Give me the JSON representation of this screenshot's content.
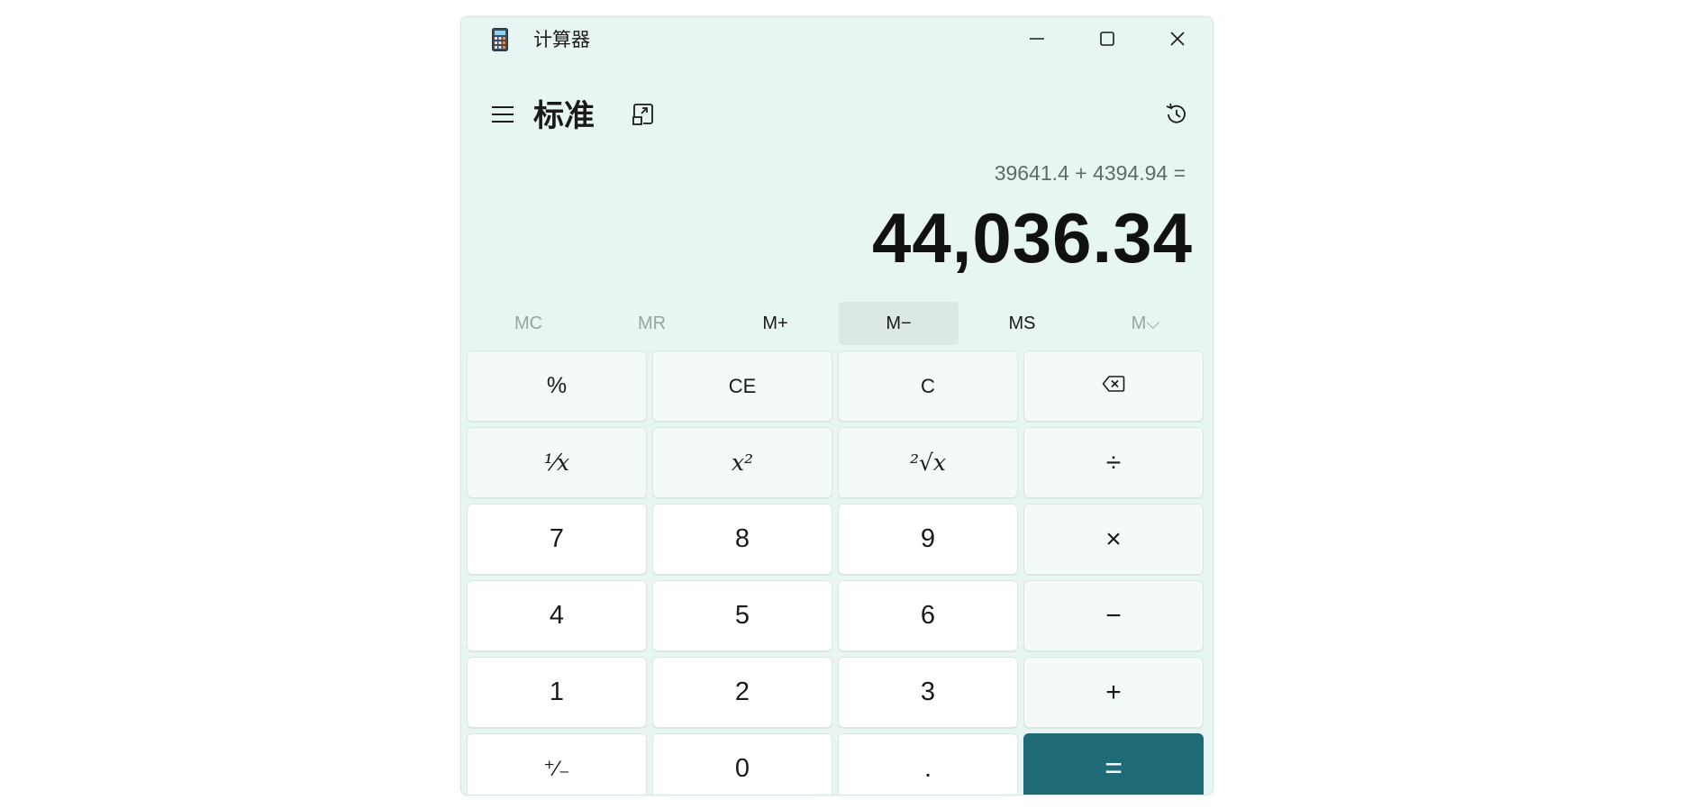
{
  "window": {
    "app_title": "计算器",
    "icons": {
      "app": "calculator-icon",
      "minimize": "minimize-icon",
      "maximize": "maximize-icon",
      "close": "close-icon"
    }
  },
  "header": {
    "mode_title": "标准",
    "icons": {
      "menu": "hamburger-menu-icon",
      "keep_on_top": "keep-on-top-icon",
      "history": "history-icon"
    }
  },
  "display": {
    "expression": "39641.4 + 4394.94 =",
    "result": "44,036.34"
  },
  "memory": [
    {
      "label": "MC",
      "enabled": false
    },
    {
      "label": "MR",
      "enabled": false
    },
    {
      "label": "M+",
      "enabled": true
    },
    {
      "label": "M−",
      "enabled": true,
      "hovered": true
    },
    {
      "label": "MS",
      "enabled": true
    },
    {
      "label": "M⌵",
      "enabled": false
    }
  ],
  "keys": {
    "percent": "%",
    "clear_entry": "CE",
    "clear": "C",
    "backspace": "backspace-icon",
    "reciprocal": "⅟x",
    "square": "x²",
    "sqrt": "²√x",
    "divide": "÷",
    "seven": "7",
    "eight": "8",
    "nine": "9",
    "multiply": "×",
    "four": "4",
    "five": "5",
    "six": "6",
    "minus": "−",
    "one": "1",
    "two": "2",
    "three": "3",
    "plus": "+",
    "negate": "⁺∕₋",
    "zero": "0",
    "decimal": ".",
    "equals": "="
  },
  "colors": {
    "window_bg": "#e8f6f3",
    "equals_bg": "#1f6b78"
  }
}
